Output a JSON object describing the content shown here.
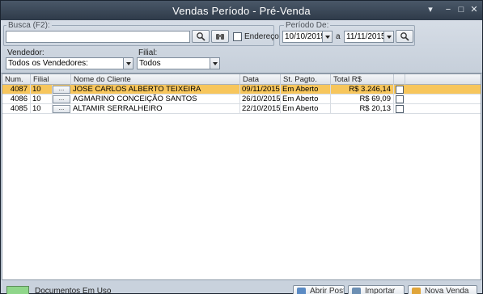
{
  "window": {
    "title": "Vendas Período - Pré-Venda",
    "controls": [
      "▾",
      "−",
      "□",
      "✕"
    ]
  },
  "search": {
    "label": "Busca (F2):",
    "value": "",
    "endereco_label": "Endereço"
  },
  "periodo": {
    "label": "Período De:",
    "from": "10/10/2015",
    "sep": "a",
    "to": "11/11/2015"
  },
  "vendedor": {
    "label": "Vendedor:",
    "value": "Todos os Vendedores:"
  },
  "filial": {
    "label": "Filial:",
    "value": "Todos"
  },
  "table": {
    "columns": [
      "Num.",
      "Filial",
      "Nome do Cliente",
      "Data",
      "St. Pagto.",
      "Total R$"
    ],
    "rows": [
      {
        "num": "4087",
        "filial": "10",
        "btn": "...",
        "cliente": "JOSE CARLOS ALBERTO TEIXEIRA",
        "data": "09/11/2015",
        "status": "Em Aberto",
        "total": "R$ 3.246,14",
        "selected": true
      },
      {
        "num": "4086",
        "filial": "10",
        "btn": "...",
        "cliente": "AGMARINO CONCEIÇÃO SANTOS",
        "data": "26/10/2015",
        "status": "Em Aberto",
        "total": "R$ 69,09",
        "selected": false
      },
      {
        "num": "4085",
        "filial": "10",
        "btn": "...",
        "cliente": "ALTAMIR SERRALHEIRO",
        "data": "22/10/2015",
        "status": "Em Aberto",
        "total": "R$ 20,13",
        "selected": false
      }
    ]
  },
  "footer": {
    "legend": "Documentos Em Uso",
    "legend_color": "#8fd68a",
    "buttons": [
      {
        "label": "Abrir Post",
        "icon": "open-icon"
      },
      {
        "label": "Importar",
        "icon": "import-icon"
      },
      {
        "label": "Nova Venda",
        "icon": "new-sale-icon"
      }
    ]
  },
  "colors": {
    "selected_row": "#f7c65c",
    "titlebar": "#2e3a49",
    "panel": "#c9d2dd"
  }
}
